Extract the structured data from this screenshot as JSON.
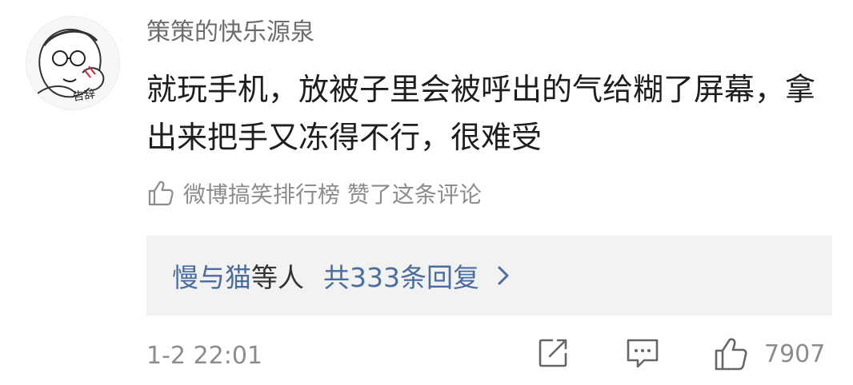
{
  "comment": {
    "username": "策策的快乐源泉",
    "text": "就玩手机，放被子里会被呼出的气给糊了屏幕，拿出来把手又冻得不行，很难受",
    "avatar_text": "告辞",
    "liked_note": "微博搞笑排行榜 赞了这条评论",
    "replies": {
      "names": "慢与猫",
      "others": "等人",
      "count_text": "共333条回复"
    },
    "timestamp": "1-2 22:01",
    "like_count": "7907"
  },
  "icons": {
    "liked_note_icon": "thumbs-up-outline-icon",
    "reply_arrow": "chevron-right-icon",
    "share": "share-edit-icon",
    "comment": "comment-bubble-icon",
    "like": "thumbs-up-outline-icon"
  },
  "colors": {
    "link": "#4a6d9f",
    "muted": "#8c8c8c",
    "reply_bg": "#f2f2f2"
  }
}
